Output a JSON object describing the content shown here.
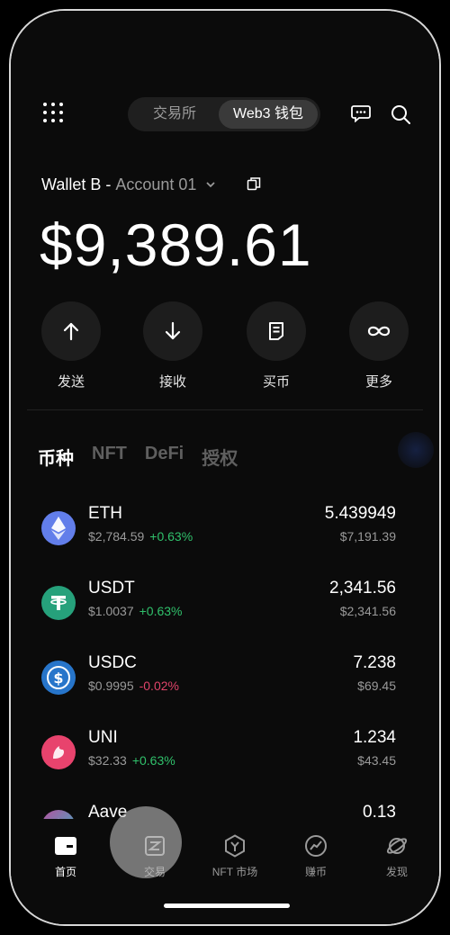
{
  "header": {
    "tabs": [
      "交易所",
      "Web3 钱包"
    ],
    "active_tab": "Web3 钱包",
    "icons": [
      "grid-menu-icon",
      "message-icon",
      "search-icon"
    ]
  },
  "wallet": {
    "name": "Wallet B",
    "separator": "-",
    "account": "Account 01",
    "balance": "$9,389.61"
  },
  "actions": [
    {
      "label": "发送",
      "icon": "arrow-up-icon"
    },
    {
      "label": "接收",
      "icon": "arrow-down-icon"
    },
    {
      "label": "买币",
      "icon": "document-icon"
    },
    {
      "label": "更多",
      "icon": "infinity-icon"
    }
  ],
  "asset_tabs": [
    "币种",
    "NFT",
    "DeFi",
    "授权"
  ],
  "tokens": [
    {
      "symbol": "ETH",
      "price": "$2,784.59",
      "change": "+0.63%",
      "quantity": "5.439949",
      "value": "$7,191.39",
      "color": "#627eea"
    },
    {
      "symbol": "USDT",
      "price": "$1.0037",
      "change": "+0.63%",
      "quantity": "2,341.56",
      "value": "$2,341.56",
      "color": "#26a17b"
    },
    {
      "symbol": "USDC",
      "price": "$0.9995",
      "change": "-0.02%",
      "quantity": "7.238",
      "value": "$69.45",
      "color": "#2775ca"
    },
    {
      "symbol": "UNI",
      "price": "$32.33",
      "change": "+0.63%",
      "quantity": "1.234",
      "value": "$43.45",
      "color": "#e8436d"
    },
    {
      "symbol": "Aave",
      "price": "",
      "change": "",
      "quantity": "0.13",
      "value": "",
      "color": "#7d56c7"
    }
  ],
  "bottom_nav": [
    {
      "label": "首页",
      "icon": "home-icon"
    },
    {
      "label": "交易",
      "icon": "trade-icon"
    },
    {
      "label": "NFT 市场",
      "icon": "nft-market-icon"
    },
    {
      "label": "赚币",
      "icon": "earn-icon"
    },
    {
      "label": "发现",
      "icon": "discover-icon"
    }
  ],
  "colors": {
    "positive": "#30c06b",
    "negative": "#e0446a",
    "background": "#0b0b0b"
  }
}
